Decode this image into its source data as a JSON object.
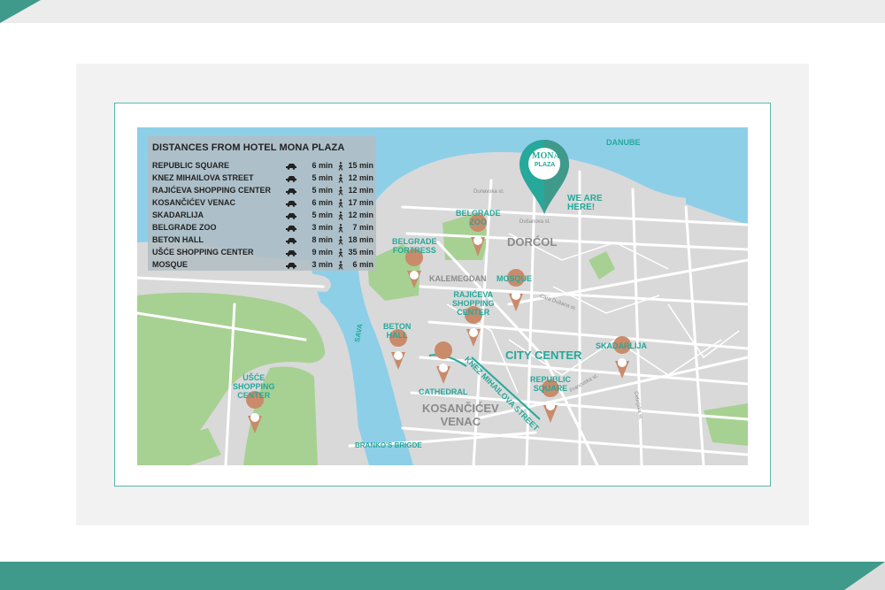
{
  "panel": {
    "title": "DISTANCES FROM HOTEL MONA PLAZA",
    "rows": [
      {
        "name": "REPUBLIC SQUARE",
        "car": "6 min",
        "walk": "15 min"
      },
      {
        "name": "KNEZ MIHAILOVA STREET",
        "car": "5 min",
        "walk": "12 min"
      },
      {
        "name": "RAJIĆEVA SHOPPING CENTER",
        "car": "5 min",
        "walk": "12 min"
      },
      {
        "name": "KOSANČIĆEV VENAC",
        "car": "6 min",
        "walk": "17 min"
      },
      {
        "name": "SKADARLIJA",
        "car": "5 min",
        "walk": "12 min"
      },
      {
        "name": "BELGRADE ZOO",
        "car": "3 min",
        "walk": "7 min"
      },
      {
        "name": "BETON HALL",
        "car": "8 min",
        "walk": "18 min"
      },
      {
        "name": "UŠĆE SHOPPING CENTER",
        "car": "9 min",
        "walk": "35 min"
      },
      {
        "name": "MOSQUE",
        "car": "3 min",
        "walk": "6 min"
      }
    ]
  },
  "logo": {
    "line1": "MONA",
    "line2": "PLAZA"
  },
  "labels": {
    "we_are_here": "WE ARE\nHERE!",
    "danube": "DANUBE",
    "sava": "SAVA",
    "dorcol": "DORĆOL",
    "kalemegdan": "KALEMEGDAN",
    "city_center": "CITY CENTER",
    "kosancicev": "KOSANČIĆEV\nVENAC",
    "knez": "KNEZ MIHAILOVA STREET",
    "branko": "BRANKO'S BRIGDE",
    "belgrade_zoo": "BELGRADE\nZOO",
    "belgrade_fortress": "BELGRADE\nFORTRESS",
    "mosque": "MOSQUE",
    "rajiceva": "RAJIĆEVA\nSHOPPING\nCENTER",
    "beton_hall": "BETON\nHALL",
    "cathedral": "CATHEDRAL",
    "republic_square": "REPUBLIC\nSQUARE",
    "skadarlija": "SKADARLIJA",
    "usce": "UŠĆE\nSHOPPING\nCENTER",
    "street_dunavska": "Dunavska st.",
    "street_dusanova": "Dušanova st.",
    "street_cara": "Cara Dušana st.",
    "street_francuska": "Francuska st.",
    "street_cetinjska": "Cetinjska st."
  },
  "colors": {
    "teal": "#3f9a8c",
    "accent": "#26a89a",
    "water": "#8ecfe8",
    "park": "#a7d192",
    "pin": "#c98b6a"
  }
}
